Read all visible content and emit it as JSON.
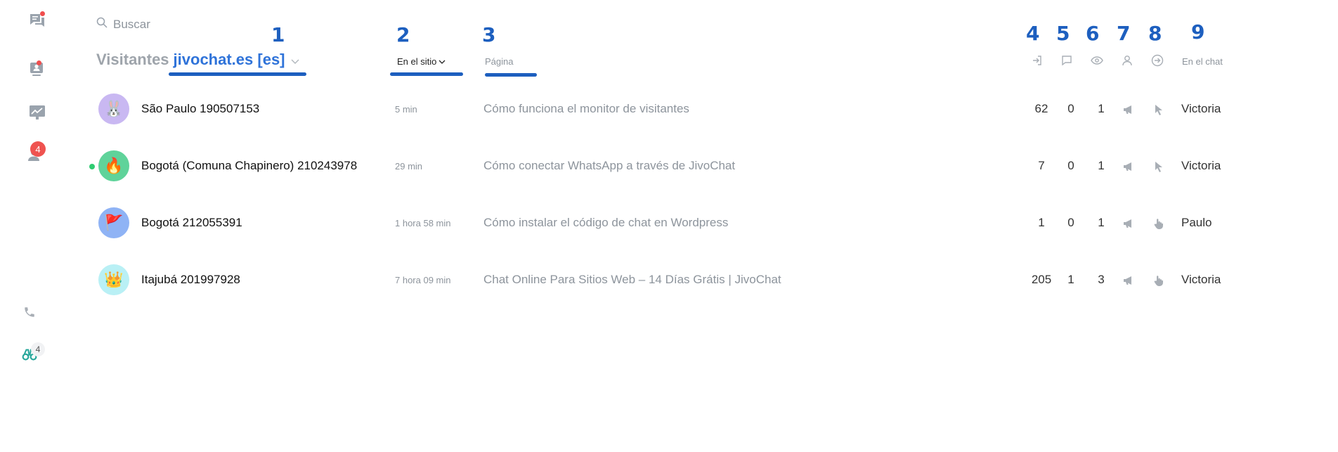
{
  "search": {
    "placeholder": "Buscar"
  },
  "header": {
    "visitors_label": "Visitantes",
    "site": "jivochat.es [es]",
    "col_on_site": "En el sitio",
    "col_page": "Página",
    "col_agent": "En el chat"
  },
  "annotations": [
    "1",
    "2",
    "3",
    "4",
    "5",
    "6",
    "7",
    "8",
    "9"
  ],
  "sidebar": {
    "visitors_badge": "4",
    "bottom_badge": "4"
  },
  "visitors": [
    {
      "name": "São Paulo 190507153",
      "time": "5 min",
      "page": "Cómo funciona el monitor de visitantes",
      "visits": "62",
      "chats": "0",
      "views": "1",
      "agent": "Victoria",
      "online": false,
      "avatar": "🐰",
      "avatar_color": "#c9b8f2",
      "action_icon": "cursor-icon"
    },
    {
      "name": "Bogotá (Comuna Chapinero) 210243978",
      "time": "29 min",
      "page": "Cómo conectar WhatsApp a través de JivoChat",
      "visits": "7",
      "chats": "0",
      "views": "1",
      "agent": "Victoria",
      "online": true,
      "avatar": "🔥",
      "avatar_color": "#5fd39a",
      "action_icon": "cursor-icon"
    },
    {
      "name": "Bogotá 212055391",
      "time": "1 hora 58 min",
      "page": "Cómo instalar el código de chat en Wordpress",
      "visits": "1",
      "chats": "0",
      "views": "1",
      "agent": "Paulo",
      "online": false,
      "avatar": "🚩",
      "avatar_color": "#8fb3f5",
      "action_icon": "hand-pointer-icon"
    },
    {
      "name": "Itajubá 201997928",
      "time": "7 hora 09 min",
      "page": "Chat Online Para Sitios Web – 14 Días Grátis | JivoChat",
      "visits": "205",
      "chats": "1",
      "views": "3",
      "agent": "Victoria",
      "online": false,
      "avatar": "👑",
      "avatar_color": "#b9f0f5",
      "action_icon": "hand-pointer-icon"
    }
  ],
  "colors": {
    "accent": "#2f73d9",
    "annotation": "#1d5fbf",
    "online": "#2ecc71",
    "badge": "#ef5350"
  }
}
